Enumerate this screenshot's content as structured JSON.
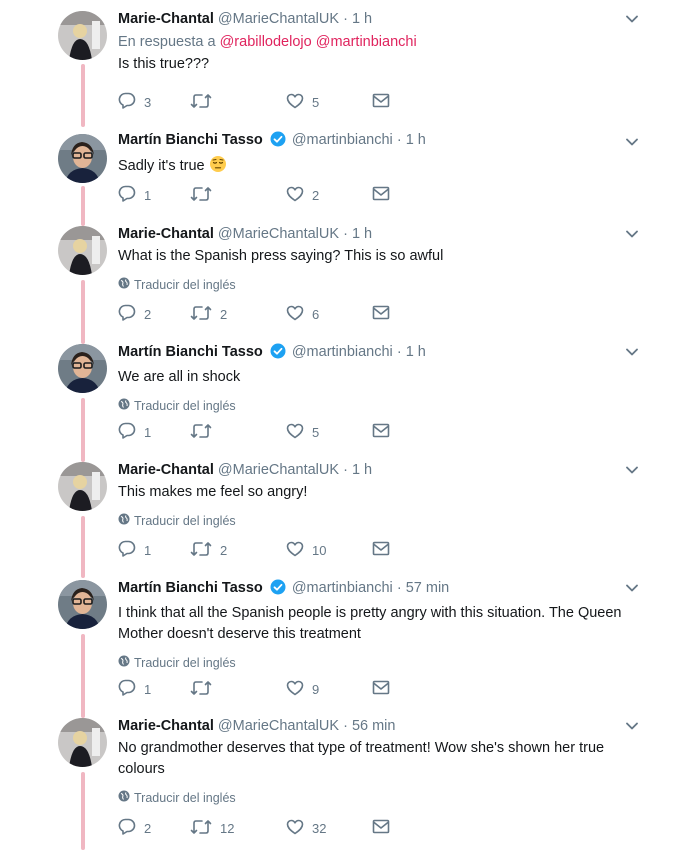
{
  "tweets": [
    {
      "author": "marie",
      "name": "Marie-Chantal",
      "handle": "@MarieChantalUK",
      "dot": "·",
      "time": "1 h",
      "verified": false,
      "reply_label": "En respuesta a",
      "reply_mentions": [
        "@rabillodelojo",
        "@martinbianchi"
      ],
      "text": "Is this true???",
      "translate": "",
      "replies": "3",
      "retweets": "",
      "likes": "5"
    },
    {
      "author": "martin",
      "name": "Martín Bianchi Tasso",
      "handle": "@martinbianchi",
      "dot": "·",
      "time": "1 h",
      "verified": true,
      "text": "Sadly it's true",
      "emoji": "pensive-face-emoji",
      "translate": "",
      "replies": "1",
      "retweets": "",
      "likes": "2"
    },
    {
      "author": "marie",
      "name": "Marie-Chantal",
      "handle": "@MarieChantalUK",
      "dot": "·",
      "time": "1 h",
      "verified": false,
      "text": "What is the Spanish press saying? This is so awful",
      "translate": "Traducir del inglés",
      "replies": "2",
      "retweets": "2",
      "likes": "6"
    },
    {
      "author": "martin",
      "name": "Martín Bianchi Tasso",
      "handle": "@martinbianchi",
      "dot": "·",
      "time": "1 h",
      "verified": true,
      "text": "We are all in shock",
      "translate": "Traducir del inglés",
      "replies": "1",
      "retweets": "",
      "likes": "5"
    },
    {
      "author": "marie",
      "name": "Marie-Chantal",
      "handle": "@MarieChantalUK",
      "dot": "·",
      "time": "1 h",
      "verified": false,
      "text": "This makes me feel so angry!",
      "translate": "Traducir del inglés",
      "replies": "1",
      "retweets": "2",
      "likes": "10"
    },
    {
      "author": "martin",
      "name": "Martín Bianchi Tasso",
      "handle": "@martinbianchi",
      "dot": "·",
      "time": "57 min",
      "verified": true,
      "text": "I think that all the Spanish people is pretty angry with this situation. The Queen Mother doesn't deserve this treatment",
      "translate": "Traducir del inglés",
      "replies": "1",
      "retweets": "",
      "likes": "9"
    },
    {
      "author": "marie",
      "name": "Marie-Chantal",
      "handle": "@MarieChantalUK",
      "dot": "·",
      "time": "56 min",
      "verified": false,
      "text": "No grandmother deserves that type of treatment! Wow she's shown her true colours",
      "translate": "Traducir del inglés",
      "replies": "2",
      "retweets": "12",
      "likes": "32"
    }
  ],
  "icons": {
    "reply": "reply-icon",
    "retweet": "retweet-icon",
    "like": "heart-icon",
    "dm": "envelope-icon",
    "caret": "chevron-down-icon",
    "globe": "globe-icon",
    "verified": "verified-badge-icon"
  },
  "colors": {
    "text": "#14171a",
    "muted": "#657786",
    "mention": "#e0245e",
    "verified": "#1da1f2",
    "thread_line": "#f0b7c2"
  }
}
